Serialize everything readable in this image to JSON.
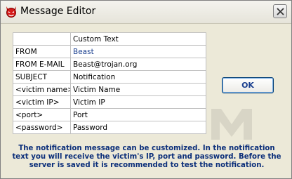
{
  "window": {
    "title": "Message Editor",
    "app_icon": "devil-icon",
    "close_icon": "close-icon"
  },
  "table": {
    "header": {
      "label": "",
      "value": "Custom Text"
    },
    "rows": [
      {
        "label": "FROM",
        "value": "Beast",
        "value_color": "#1a3f8f"
      },
      {
        "label": "FROM E-MAIL",
        "value": "Beast@trojan.org"
      },
      {
        "label": "SUBJECT",
        "value": "Notification"
      },
      {
        "label": "<victim name>",
        "value": "Victim Name"
      },
      {
        "label": "<victim IP>",
        "value": "Victim IP"
      },
      {
        "label": "<port>",
        "value": "Port"
      },
      {
        "label": "<password>",
        "value": "Password"
      }
    ]
  },
  "buttons": {
    "ok_label": "OK"
  },
  "notice": {
    "text": "The notification message can be customized. In the notification text you will receive the victim's IP, port and password. Before the server is saved it is recommended to test the notification."
  },
  "colors": {
    "background": "#ece9d8",
    "notice_text": "#0c2f7a",
    "button_text": "#1a3f8f"
  }
}
